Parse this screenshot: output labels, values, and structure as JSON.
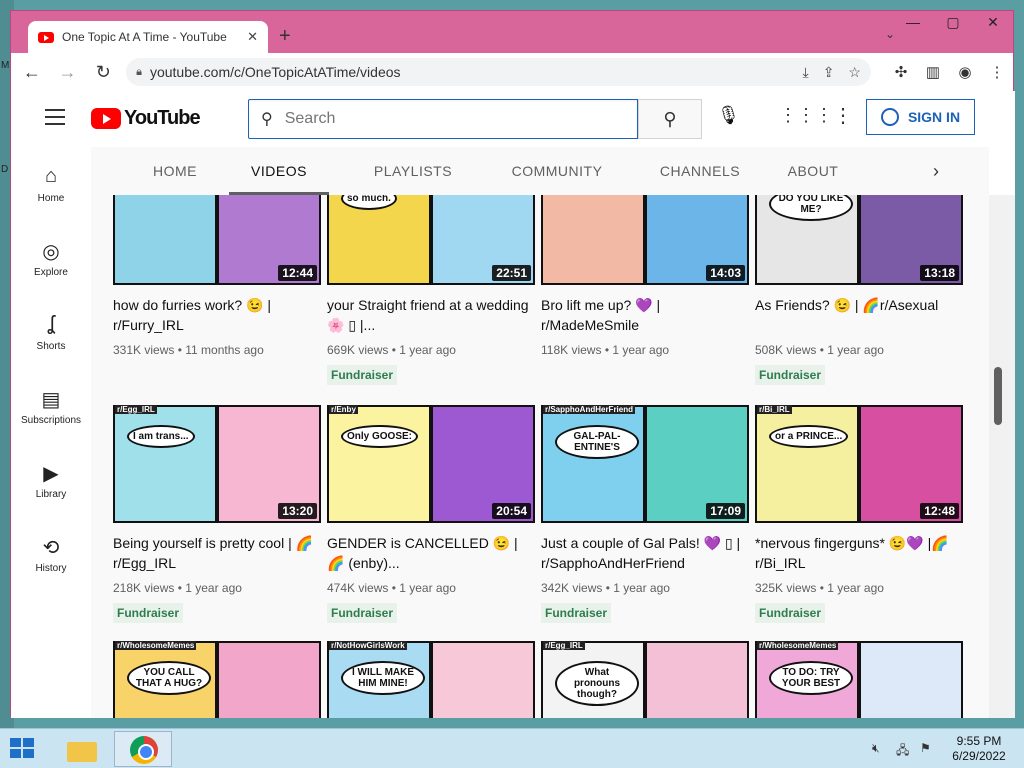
{
  "desktop": {
    "left_labels": [
      "M",
      "D"
    ]
  },
  "browser": {
    "tab_title": "One Topic At A Time - YouTube",
    "tab_close": "✕",
    "new_tab": "+",
    "tab_dropdown": "⌄",
    "window_controls": {
      "minimize": "—",
      "maximize": "▢",
      "close": "✕"
    },
    "back": "←",
    "forward": "→",
    "reload": "↻",
    "url": "youtube.com/c/OneTopicAtATime/videos",
    "omnibox_icons": [
      "download-icon",
      "share-icon",
      "bookmark-star-icon"
    ],
    "toolbar_icons": [
      "extensions-icon",
      "side-panel-icon",
      "profile-icon",
      "menu-icon"
    ]
  },
  "youtube": {
    "logo_text": "YouTube",
    "search_placeholder": "Search",
    "sign_in": "SIGN IN",
    "sidebar": [
      {
        "label": "Home",
        "icon": "⌂",
        "name": "home"
      },
      {
        "label": "Explore",
        "icon": "◎",
        "name": "explore"
      },
      {
        "label": "Shorts",
        "icon": "ʆ",
        "name": "shorts"
      },
      {
        "label": "Subscriptions",
        "icon": "▤",
        "name": "subscriptions"
      },
      {
        "label": "Library",
        "icon": "▶",
        "name": "library"
      },
      {
        "label": "History",
        "icon": "⟲",
        "name": "history"
      }
    ],
    "channel_tabs": [
      "HOME",
      "VIDEOS",
      "PLAYLISTS",
      "COMMUNITY",
      "CHANNELS",
      "ABOUT"
    ],
    "active_tab": "VIDEOS",
    "fundraiser_label": "Fundraiser",
    "rows": [
      [
        {
          "title": "how do furries work? 😉 | r/Furry_IRL",
          "views": "331K views",
          "age": "11 months ago",
          "duration": "12:44",
          "fundraiser": false,
          "colors": [
            "#8fd3e8",
            "#b07ad0"
          ],
          "tag": "",
          "bubble": ""
        },
        {
          "title": "your Straight friend at a wedding🌸 ▯ |...",
          "views": "669K views",
          "age": "1 year ago",
          "duration": "22:51",
          "fundraiser": true,
          "colors": [
            "#f4d64c",
            "#9fd8f0"
          ],
          "tag": "",
          "bubble": "so much."
        },
        {
          "title": "Bro lift me up? 💜 | r/MadeMeSmile",
          "views": "118K views",
          "age": "1 year ago",
          "duration": "14:03",
          "fundraiser": false,
          "colors": [
            "#f2b9a4",
            "#6bb5e8"
          ],
          "tag": "",
          "bubble": ""
        },
        {
          "title": "As Friends? 😉 | 🌈r/Asexual",
          "views": "508K views",
          "age": "1 year ago",
          "duration": "13:18",
          "fundraiser": true,
          "colors": [
            "#e6e6e6",
            "#7b5aa6"
          ],
          "tag": "",
          "bubble": "DO YOU LIKE ME?"
        }
      ],
      [
        {
          "title": "Being yourself is pretty cool | 🌈r/Egg_IRL",
          "views": "218K views",
          "age": "1 year ago",
          "duration": "13:20",
          "fundraiser": true,
          "colors": [
            "#9fe0ea",
            "#f7b6d2"
          ],
          "tag": "r/Egg_IRL",
          "bubble": "I am trans..."
        },
        {
          "title": "GENDER is CANCELLED 😉 | 🌈 (enby)...",
          "views": "474K views",
          "age": "1 year ago",
          "duration": "20:54",
          "fundraiser": true,
          "colors": [
            "#fbf3a0",
            "#9c59d1"
          ],
          "tag": "r/Enby",
          "bubble": "Only GOOSE:"
        },
        {
          "title": "Just a couple of Gal Pals! 💜 ▯ | r/SapphoAndHerFriend",
          "views": "342K views",
          "age": "1 year ago",
          "duration": "17:09",
          "fundraiser": true,
          "colors": [
            "#7fd0ee",
            "#5ccfc3"
          ],
          "tag": "r/SapphoAndHerFriend",
          "bubble": "GAL-PAL-ENTINE'S"
        },
        {
          "title": "*nervous fingerguns* 😉💜 |🌈 r/Bi_IRL",
          "views": "325K views",
          "age": "1 year ago",
          "duration": "12:48",
          "fundraiser": true,
          "colors": [
            "#f4f0a0",
            "#d64fa0"
          ],
          "tag": "r/Bi_IRL",
          "bubble": "or a PRINCE..."
        }
      ],
      [
        {
          "title": "",
          "views": "",
          "age": "",
          "duration": "",
          "fundraiser": false,
          "colors": [
            "#f7d36a",
            "#f2a6c9"
          ],
          "tag": "r/WholesomeMemes",
          "bubble": "YOU CALL THAT A HUG?"
        },
        {
          "title": "",
          "views": "",
          "age": "",
          "duration": "",
          "fundraiser": false,
          "colors": [
            "#a9dcf2",
            "#f6c8d8"
          ],
          "tag": "r/NotHowGirlsWork",
          "bubble": "I WILL MAKE HIM MINE!"
        },
        {
          "title": "",
          "views": "",
          "age": "",
          "duration": "",
          "fundraiser": false,
          "colors": [
            "#f3f3f3",
            "#f4c0d6"
          ],
          "tag": "r/Egg_IRL",
          "bubble": "What pronouns though?"
        },
        {
          "title": "",
          "views": "",
          "age": "",
          "duration": "",
          "fundraiser": false,
          "colors": [
            "#f0a8d8",
            "#dde8f8"
          ],
          "tag": "r/WholesomeMemes",
          "bubble": "TO DO: TRY YOUR BEST"
        }
      ]
    ]
  },
  "taskbar": {
    "time": "9:55 PM",
    "date": "6/29/2022",
    "tray_icons": [
      "volume-muted-icon",
      "network-icon",
      "action-center-icon"
    ]
  }
}
